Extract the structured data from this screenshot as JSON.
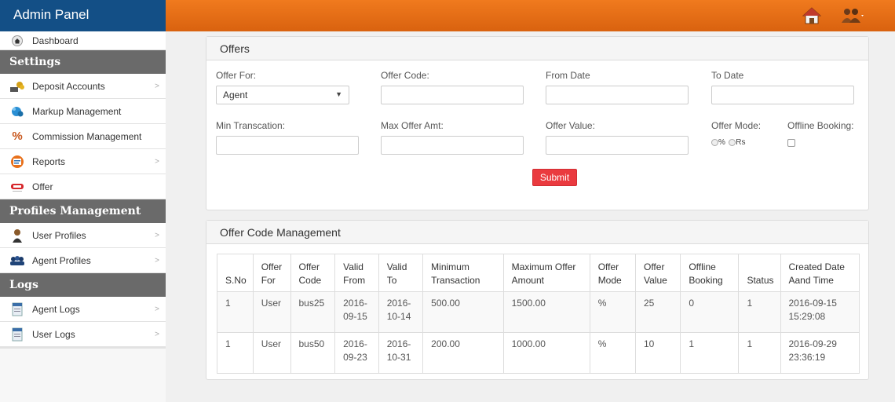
{
  "brand": {
    "title": "Admin Panel"
  },
  "topbar": {
    "icons": [
      "home-icon",
      "users-icon"
    ]
  },
  "sidebar": {
    "dashboard": "Dashboard",
    "sections": {
      "settings": "Settings",
      "profiles": "Profiles Management",
      "logs": "Logs"
    },
    "settings_items": [
      {
        "label": "Deposit Accounts",
        "icon": "deposit-icon",
        "chevron": true
      },
      {
        "label": "Markup Management",
        "icon": "markup-icon",
        "chevron": false
      },
      {
        "label": "Commission Management",
        "icon": "percent-icon",
        "chevron": false
      },
      {
        "label": "Reports",
        "icon": "reports-icon",
        "chevron": true
      },
      {
        "label": "Offer",
        "icon": "offer-icon",
        "chevron": false
      }
    ],
    "profile_items": [
      {
        "label": "User Profiles",
        "icon": "user-icon",
        "chevron": true
      },
      {
        "label": "Agent Profiles",
        "icon": "agent-icon",
        "chevron": true
      }
    ],
    "log_items": [
      {
        "label": "Agent Logs",
        "icon": "log-icon",
        "chevron": true
      },
      {
        "label": "User Logs",
        "icon": "log-icon",
        "chevron": true
      }
    ]
  },
  "offers": {
    "title": "Offers",
    "offer_for_label": "Offer For:",
    "offer_for_value": "Agent",
    "offer_code_label": "Offer Code:",
    "from_date_label": "From Date",
    "to_date_label": "To Date",
    "min_transaction_label": "Min Transcation:",
    "max_offer_label": "Max Offer Amt:",
    "offer_value_label": "Offer Value:",
    "offer_mode_label": "Offer Mode:",
    "offer_mode_pct": "%",
    "offer_mode_rs": "Rs",
    "offline_booking_label": "Offline Booking:",
    "submit_label": "Submit",
    "submit_color": "#ea3a3f"
  },
  "ocm": {
    "title": "Offer Code Management",
    "headers": [
      [
        "S.No"
      ],
      [
        "Offer",
        "For"
      ],
      [
        "Offer",
        "Code"
      ],
      [
        "Valid",
        "From"
      ],
      [
        "Valid",
        "To"
      ],
      [
        "Minimum",
        "Transaction"
      ],
      [
        "Maximum Offer",
        "Amount"
      ],
      [
        "Offer",
        "Mode"
      ],
      [
        "Offer",
        "Value"
      ],
      [
        "Offline",
        "Booking"
      ],
      [
        "Status"
      ],
      [
        "Created Date",
        "Aand Time"
      ]
    ],
    "rows": [
      [
        [
          "1"
        ],
        [
          "User"
        ],
        [
          "bus25"
        ],
        [
          "2016-",
          "09-15"
        ],
        [
          "2016-",
          "10-14"
        ],
        [
          "500.00"
        ],
        [
          "1500.00"
        ],
        [
          "%"
        ],
        [
          "25"
        ],
        [
          "0"
        ],
        [
          "1"
        ],
        [
          "2016-09-15",
          "15:29:08"
        ]
      ],
      [
        [
          "1"
        ],
        [
          "User"
        ],
        [
          "bus50"
        ],
        [
          "2016-",
          "09-23"
        ],
        [
          "2016-",
          "10-31"
        ],
        [
          "200.00"
        ],
        [
          "1000.00"
        ],
        [
          "%"
        ],
        [
          "10"
        ],
        [
          "1"
        ],
        [
          "1"
        ],
        [
          "2016-09-29",
          "23:36:19"
        ]
      ]
    ]
  },
  "colors": {
    "topbar": "#e8701a",
    "brand": "#134f86",
    "section_head": "#6a6a6a"
  }
}
